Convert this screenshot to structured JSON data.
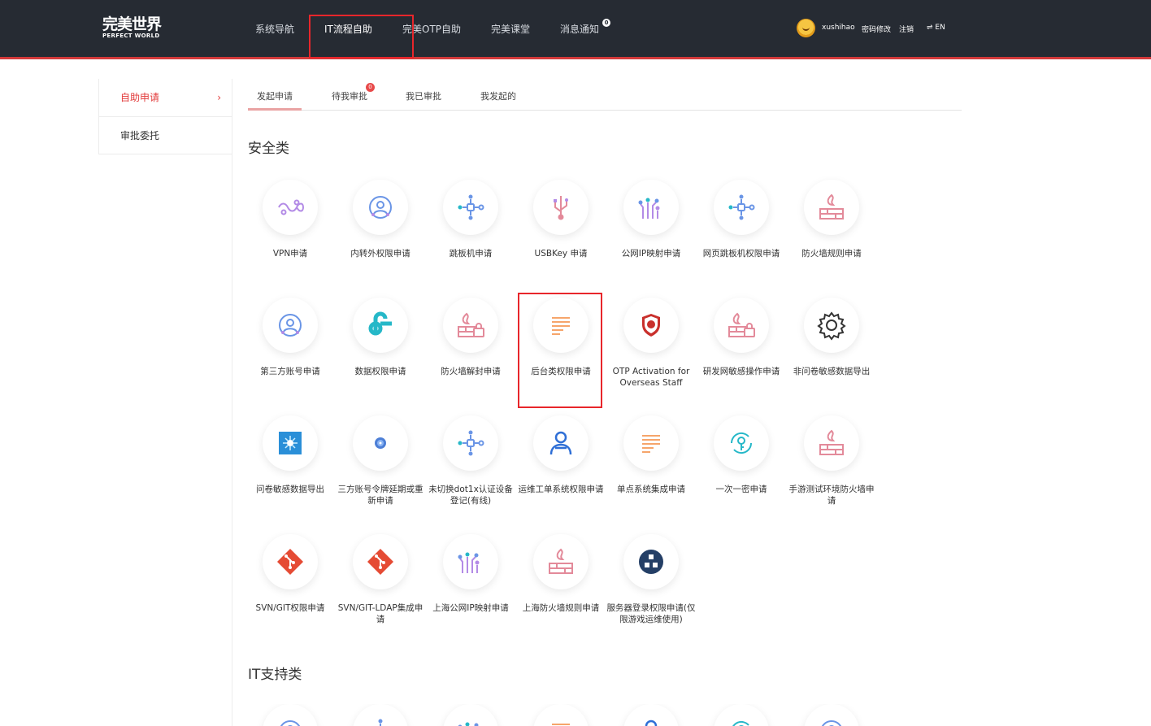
{
  "header": {
    "logo_cn": "完美世界",
    "logo_en": "PERFECT WORLD",
    "nav": [
      {
        "label": "系统导航"
      },
      {
        "label": "IT流程自助"
      },
      {
        "label": "完美OTP自助"
      },
      {
        "label": "完美课堂"
      },
      {
        "label": "消息通知"
      }
    ],
    "notify_count": "0",
    "user": {
      "username": "xushihao",
      "change_password": "密码修改",
      "logout": "注销",
      "lang": "⇌ EN"
    }
  },
  "sidebar": {
    "items": [
      {
        "label": "自助申请",
        "arrow": "›"
      },
      {
        "label": "审批委托"
      }
    ]
  },
  "tabs": {
    "items": [
      {
        "label": "发起申请"
      },
      {
        "label": "待我审批"
      },
      {
        "label": "我已审批"
      },
      {
        "label": "我发起的"
      }
    ],
    "pending_count": "0"
  },
  "sections": [
    {
      "title": "安全类"
    },
    {
      "title": "IT支持类"
    }
  ],
  "security_items": [
    {
      "label": "VPN申请",
      "icon": "vpn-icon"
    },
    {
      "label": "内转外权限申请",
      "icon": "user-network-icon"
    },
    {
      "label": "跳板机申请",
      "icon": "node-hub-icon"
    },
    {
      "label": "USBKey 申请",
      "icon": "usb-icon"
    },
    {
      "label": "公网IP映射申请",
      "icon": "circuit-icon"
    },
    {
      "label": "网页跳板机权限申请",
      "icon": "node-hub-icon"
    },
    {
      "label": "防火墙规则申请",
      "icon": "firewall-icon"
    },
    {
      "label": "第三方账号申请",
      "icon": "user-network-icon"
    },
    {
      "label": "数据权限申请",
      "icon": "data-logo-icon"
    },
    {
      "label": "防火墙解封申请",
      "icon": "firewall-lock-icon"
    },
    {
      "label": "后台类权限申请",
      "icon": "document-lines-icon"
    },
    {
      "label": "OTP Activation for Overseas Staff",
      "icon": "shield-icon"
    },
    {
      "label": "研发网敏感操作申请",
      "icon": "firewall-lock-icon"
    },
    {
      "label": "非问卷敏感数据导出",
      "icon": "gear-icon"
    },
    {
      "label": "问卷敏感数据导出",
      "icon": "data-export-icon"
    },
    {
      "label": "三方账号令牌延期或重新申请",
      "icon": "token-icon"
    },
    {
      "label": "未切换dot1x认证设备登记(有线)",
      "icon": "node-hub-icon"
    },
    {
      "label": "运维工单系统权限申请",
      "icon": "ops-user-icon"
    },
    {
      "label": "单点系统集成申请",
      "icon": "document-lines-icon"
    },
    {
      "label": "一次一密申请",
      "icon": "key-cycle-icon"
    },
    {
      "label": "手游测试环境防火墙申请",
      "icon": "firewall-icon"
    },
    {
      "label": "SVN/GIT权限申请",
      "icon": "git-icon"
    },
    {
      "label": "SVN/GIT-LDAP集成申请",
      "icon": "git-icon"
    },
    {
      "label": "上海公网IP映射申请",
      "icon": "circuit-icon"
    },
    {
      "label": "上海防火墙规则申请",
      "icon": "firewall-icon"
    },
    {
      "label": "服务器登录权限申请(仅限游戏运维使用)",
      "icon": "server-cubes-icon"
    }
  ],
  "colors": {
    "header_bg": "#262b33",
    "accent_red": "#d3393a",
    "purple": "#b38be6",
    "blue": "#6a95e6",
    "teal": "#26b8c8",
    "orange": "#f6a56b",
    "pink": "#e38a9a"
  }
}
